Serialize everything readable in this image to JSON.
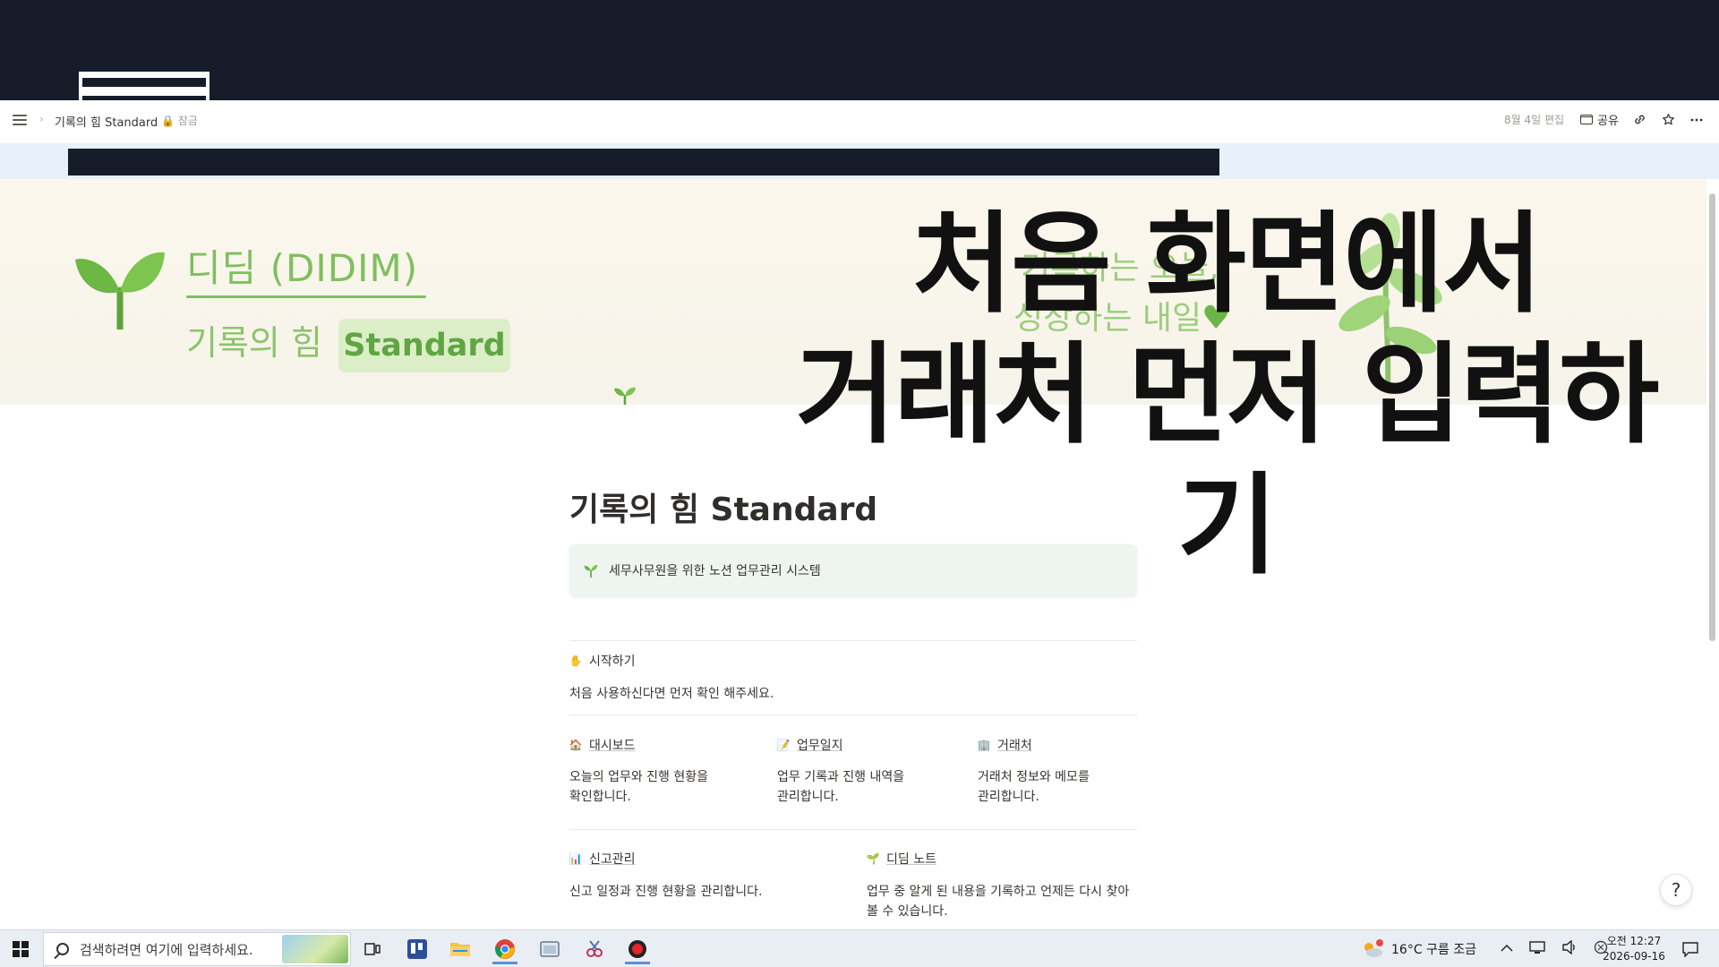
{
  "notion_bar": {
    "breadcrumb_title": "기록의 힘 Standard",
    "breadcrumb_lock": "🔒 잠금",
    "edited": "8월 4일 편집",
    "share_label": "공유"
  },
  "cover": {
    "brand": "디딤 (DIDIM)",
    "brand_sub": "기록의 힘",
    "brand_badge": "Standard",
    "slogan_line1": "기록하는 오늘,",
    "slogan_line2": "성장하는 내일",
    "heart": "♥"
  },
  "caption": {
    "line1": "처음 화면에서",
    "line2": "거래처 먼저 입력하기"
  },
  "page": {
    "title": "기록의 힘 Standard",
    "callout": "세무사무원을 위한 노션 업무관리 시스템",
    "start_section": {
      "icon": "hand-icon",
      "label": "시작하기",
      "desc": "처음 사용하신다면 먼저 확인 해주세요."
    },
    "links_row1": [
      {
        "icon": "house-icon",
        "label": "대시보드",
        "desc_line1": "오늘의 업무와 진행 현황을",
        "desc_line2": "확인합니다."
      },
      {
        "icon": "memo-icon",
        "label": "업무일지",
        "desc_line1": "업무 기록과 진행 내역을",
        "desc_line2": "관리합니다."
      },
      {
        "icon": "building-icon",
        "label": "거래처",
        "desc_line1": "거래처 정보와 메모를",
        "desc_line2": "관리합니다."
      }
    ],
    "links_row2": [
      {
        "icon": "chart-icon",
        "label": "신고관리",
        "desc_line1": "신고 일정과 진행 현황을 관리합니다.",
        "desc_line2": ""
      },
      {
        "icon": "sprout-icon",
        "label": "디딤 노트",
        "desc_line1": "업무 중 알게 된 내용을 기록하고 언제든 다시 찾아",
        "desc_line2": "볼 수 있습니다."
      }
    ]
  },
  "taskbar": {
    "search_placeholder": "검색하려면 여기에 입력하세요.",
    "weather": "16°C 구름 조금",
    "clock_time": "오전 12:27",
    "clock_date": "2026-09-16"
  },
  "colors": {
    "top_band": "#161c29",
    "brand_green": "#7fbf5f",
    "callout_bg": "#eef5f0"
  }
}
